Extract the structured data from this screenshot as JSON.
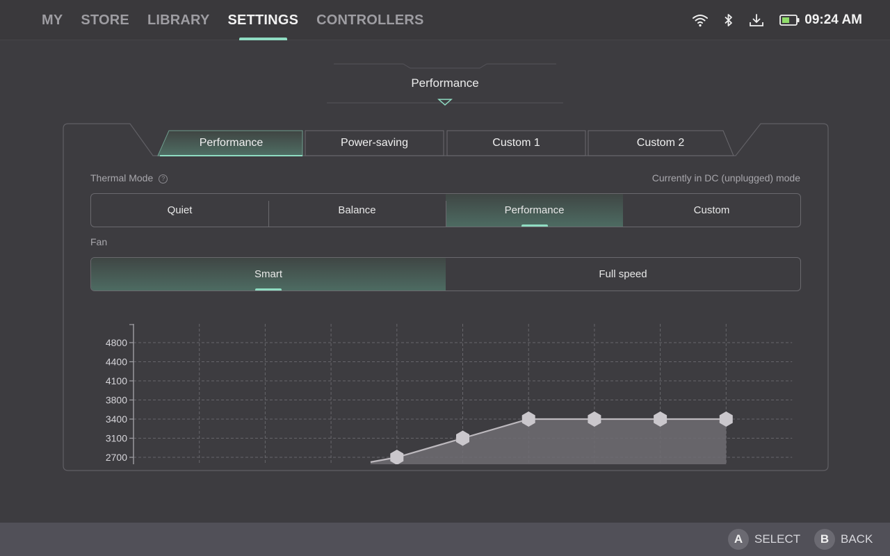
{
  "nav": {
    "items": [
      {
        "label": "MY",
        "active": false
      },
      {
        "label": "STORE",
        "active": false
      },
      {
        "label": "LIBRARY",
        "active": false
      },
      {
        "label": "SETTINGS",
        "active": true
      },
      {
        "label": "CONTROLLERS",
        "active": false
      }
    ]
  },
  "status": {
    "icons": [
      "wifi-icon",
      "bluetooth-icon",
      "download-icon",
      "battery-icon"
    ],
    "time": "09:24 AM"
  },
  "section_title": "Performance",
  "profile_tabs": [
    {
      "label": "Performance",
      "active": true
    },
    {
      "label": "Power-saving",
      "active": false
    },
    {
      "label": "Custom 1",
      "active": false
    },
    {
      "label": "Custom 2",
      "active": false
    }
  ],
  "thermal": {
    "label": "Thermal Mode",
    "help": "?",
    "status_text": "Currently in DC (unplugged) mode",
    "options": [
      "Quiet",
      "Balance",
      "Performance",
      "Custom"
    ],
    "selected": "Performance"
  },
  "fan": {
    "label": "Fan",
    "options": [
      "Smart",
      "Full speed"
    ],
    "selected": "Smart"
  },
  "chart_data": {
    "type": "area",
    "y_ticks": [
      2700,
      3100,
      3400,
      3800,
      4100,
      4400,
      4800
    ],
    "ylim": [
      2600,
      5050
    ],
    "x_points": [
      0,
      1,
      2,
      3,
      4,
      5,
      6,
      7,
      8,
      9
    ],
    "curve": [
      {
        "x": 3.6,
        "y": 2600,
        "marker": false
      },
      {
        "x": 4,
        "y": 2700,
        "marker": true
      },
      {
        "x": 5,
        "y": 3100,
        "marker": true
      },
      {
        "x": 6,
        "y": 3400,
        "marker": true
      },
      {
        "x": 7,
        "y": 3400,
        "marker": true
      },
      {
        "x": 8,
        "y": 3400,
        "marker": true
      },
      {
        "x": 9,
        "y": 3400,
        "marker": true
      }
    ],
    "grid": true,
    "colors": {
      "line": "#bdb9be",
      "fill": "#6e6c72",
      "marker": "#cac7cc",
      "grid": "#67666b",
      "axis": "#a09fa4"
    }
  },
  "bottom": {
    "select": {
      "button": "A",
      "label": "SELECT"
    },
    "back": {
      "button": "B",
      "label": "BACK"
    }
  },
  "colors": {
    "accent": "#8fdcc2",
    "background": "#3d3c40"
  }
}
